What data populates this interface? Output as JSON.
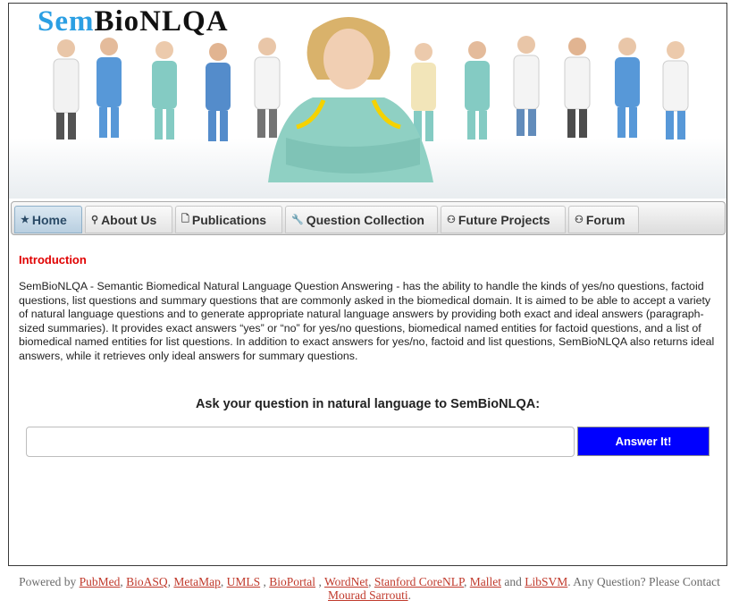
{
  "header": {
    "logo_part1": "Sem",
    "logo_part2": "BioNLQA"
  },
  "nav": {
    "items": [
      {
        "label": "Home",
        "icon": "star-icon",
        "active": true
      },
      {
        "label": "About Us",
        "icon": "search-icon"
      },
      {
        "label": "Publications",
        "icon": "document-icon"
      },
      {
        "label": "Question Collection",
        "icon": "wrench-icon"
      },
      {
        "label": "Future Projects",
        "icon": "person-icon"
      },
      {
        "label": "Forum",
        "icon": "person-icon"
      }
    ]
  },
  "intro": {
    "title": "Introduction",
    "text": "SemBioNLQA - Semantic Biomedical Natural Language Question Answering - has the ability to handle the kinds of yes/no questions, factoid questions, list questions and summary questions that are commonly asked in the biomedical domain. It is aimed to be able to accept a variety of natural language questions and to generate appropriate natural language answers by providing both exact and ideal answers (paragraph-sized summaries). It provides exact answers “yes” or “no” for yes/no questions, biomedical named entities for factoid questions, and a list of biomedical named entities for list questions. In addition to exact answers for yes/no, factoid and list questions, SemBioNLQA also returns ideal answers, while it retrieves only ideal answers for summary questions."
  },
  "question": {
    "label": "Ask your question in natural language to SemBioNLQA:",
    "input_value": "",
    "button_label": "Answer It!"
  },
  "footer": {
    "prefix": "Powered by",
    "links": [
      "PubMed",
      "BioASQ",
      "MetaMap",
      "UMLS",
      "BioPortal",
      "WordNet",
      "Stanford CoreNLP",
      "Mallet",
      "LibSVM"
    ],
    "and_text": "and",
    "suffix": ". Any Question? Please Contact",
    "contact_link": "Mourad Sarrouti",
    "end": "."
  },
  "colors": {
    "accent_red": "#e00000",
    "answer_button": "#0000ff",
    "logo_blue": "#2b9fe3",
    "link": "#c0392b"
  }
}
